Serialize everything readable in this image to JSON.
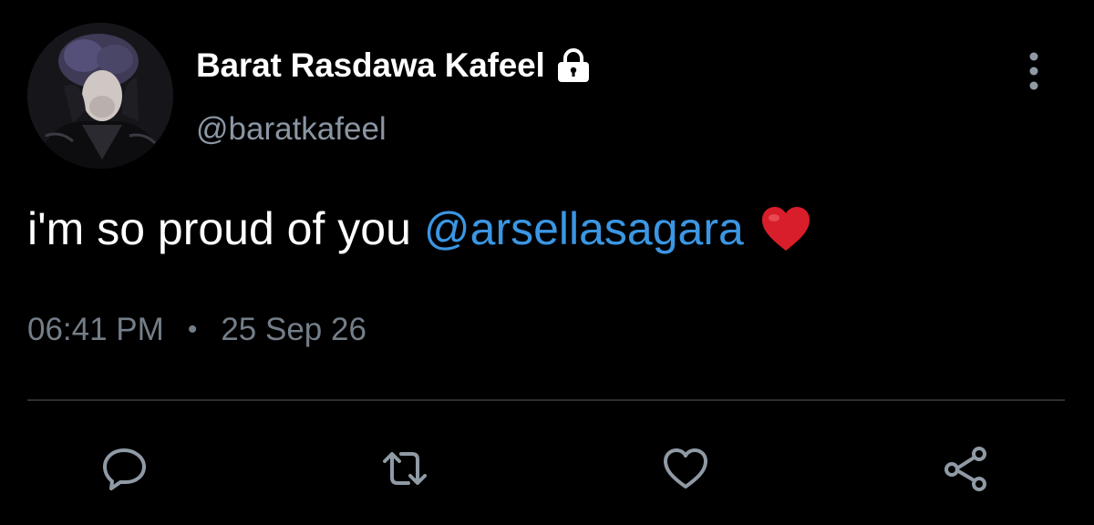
{
  "tweet": {
    "author": {
      "display_name": "Barat Rasdawa Kafeel",
      "handle": "@baratkafeel",
      "protected_icon": "lock-icon"
    },
    "text": "i'm so proud of you",
    "mention": "@arsellasagara",
    "emoji": "red-heart",
    "time": "06:41 PM",
    "separator": "•",
    "date": "25 Sep 26"
  },
  "actions": {
    "reply_icon": "reply-icon",
    "retweet_icon": "retweet-icon",
    "like_icon": "heart-icon",
    "share_icon": "share-icon",
    "more_icon": "more-vertical-icon"
  },
  "colors": {
    "background": "#000000",
    "text_primary": "#ffffff",
    "text_secondary": "#8a96a3",
    "mention": "#3b96e3",
    "icon": "#8f9aa5",
    "divider": "#2b3035",
    "heart_emoji": "#d81e2a"
  }
}
